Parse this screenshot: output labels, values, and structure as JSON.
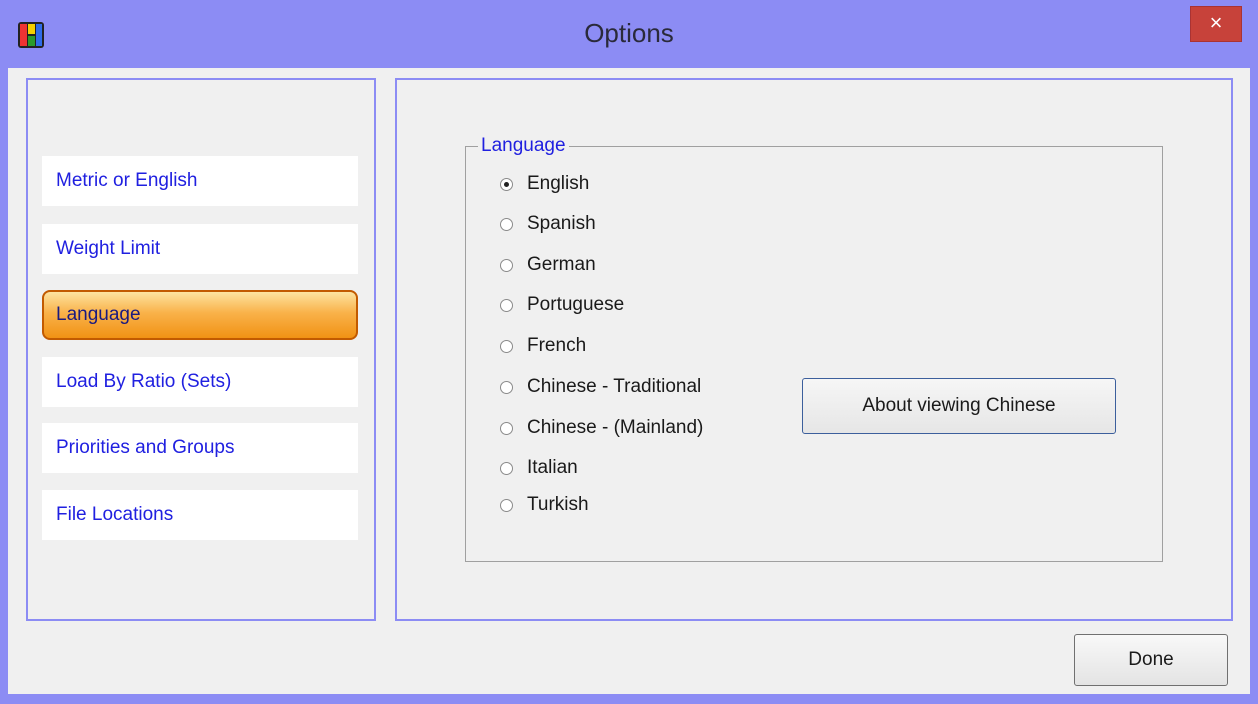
{
  "window": {
    "title": "Options",
    "close_label": "×",
    "app_icon": "app-logo-icon"
  },
  "sidebar": {
    "items": [
      {
        "label": "Metric or English",
        "active": false
      },
      {
        "label": "Weight Limit",
        "active": false
      },
      {
        "label": "Language",
        "active": true
      },
      {
        "label": "Load By Ratio (Sets)",
        "active": false
      },
      {
        "label": "Priorities and Groups",
        "active": false
      },
      {
        "label": "File Locations",
        "active": false
      }
    ]
  },
  "language_group": {
    "legend": "Language",
    "selected": "English",
    "options": [
      {
        "label": "English",
        "checked": true
      },
      {
        "label": "Spanish",
        "checked": false
      },
      {
        "label": "German",
        "checked": false
      },
      {
        "label": "Portuguese",
        "checked": false
      },
      {
        "label": "French",
        "checked": false
      },
      {
        "label": "Chinese - Traditional",
        "checked": false
      },
      {
        "label": "Chinese - (Mainland)",
        "checked": false
      },
      {
        "label": "Italian",
        "checked": false
      },
      {
        "label": "Turkish",
        "checked": false
      }
    ],
    "about_button": "About viewing Chinese"
  },
  "footer": {
    "done_label": "Done"
  },
  "colors": {
    "frame": "#8c8cf4",
    "link_text": "#2020e0",
    "active_tab": "#f19214",
    "close_button": "#c7423a"
  }
}
